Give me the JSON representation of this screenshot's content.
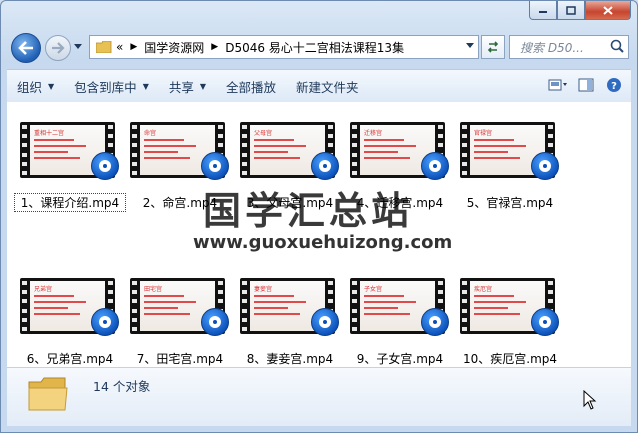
{
  "address": {
    "overflow": "«",
    "breadcrumbs": [
      "国学资源网",
      "D5046 易心十二宫相法课程13集"
    ]
  },
  "search": {
    "placeholder": "搜索 D50..."
  },
  "toolbar": {
    "organize": "组织",
    "include_library": "包含到库中",
    "share": "共享",
    "play_all": "全部播放",
    "new_folder": "新建文件夹"
  },
  "files": [
    {
      "name": "1、课程介绍.mp4",
      "slide_title": "重相十二宫"
    },
    {
      "name": "2、命宫.mp4",
      "slide_title": "命宫"
    },
    {
      "name": "3、父母宫.mp4",
      "slide_title": "父母宫"
    },
    {
      "name": "4、迁移宫.mp4",
      "slide_title": "迁移宫"
    },
    {
      "name": "5、官禄宫.mp4",
      "slide_title": "官禄宫"
    },
    {
      "name": "6、兄弟宫.mp4",
      "slide_title": "兄弟宫"
    },
    {
      "name": "7、田宅宫.mp4",
      "slide_title": "田宅宫"
    },
    {
      "name": "8、妻妾宫.mp4",
      "slide_title": "妻妾宫"
    },
    {
      "name": "9、子女宫.mp4",
      "slide_title": "子女宫"
    },
    {
      "name": "10、疾厄宫.mp4",
      "slide_title": "疾厄宫"
    }
  ],
  "watermark": {
    "title": "国学汇总站",
    "url": "www.guoxuehuizong.com"
  },
  "details": {
    "count": "14 个对象"
  }
}
